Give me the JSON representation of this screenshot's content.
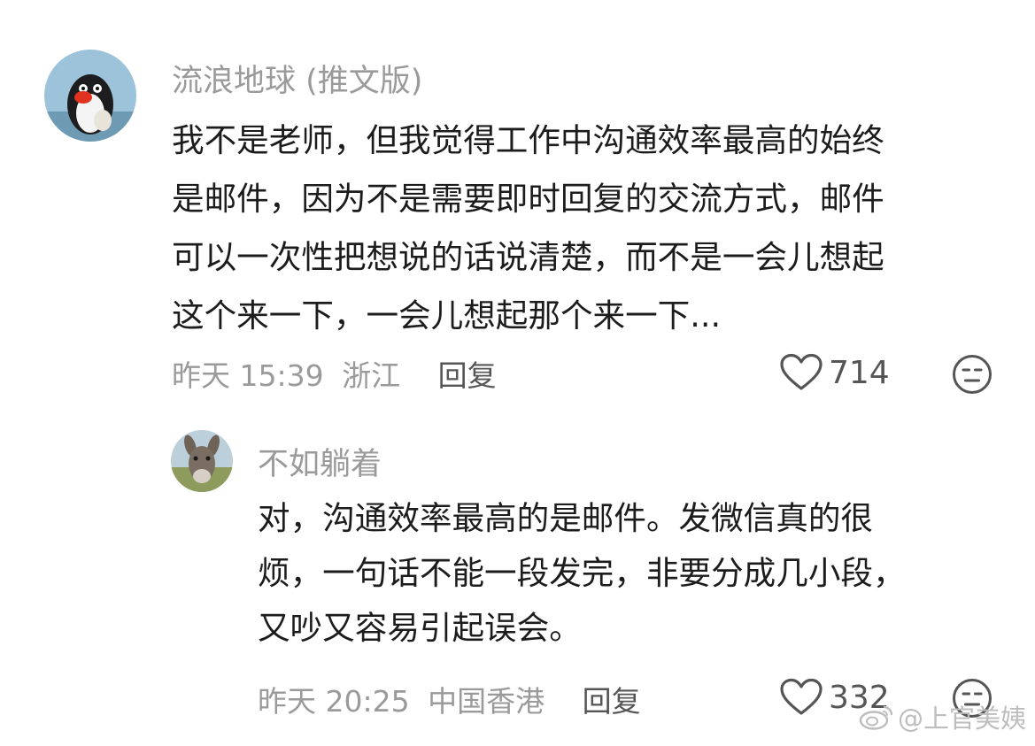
{
  "comments": [
    {
      "username": "流浪地球 (推文版)",
      "lines": [
        "我不是老师，但我觉得工作中沟通效率最高的始终",
        "是邮件，因为不是需要即时回复的交流方式，邮件",
        "可以一次性把想说的话说清楚，而不是一会儿想起",
        "这个来一下，一会儿想起那个来一下..."
      ],
      "time": "昨天 15:39",
      "location": "浙江",
      "reply_label": "回复",
      "likes": "714",
      "avatar_icon": "penguin-avatar-icon"
    },
    {
      "username": "不如躺着",
      "lines": [
        "对，沟通效率最高的是邮件。发微信真的很",
        "烦，一句话不能一段发完，非要分成几小段，",
        "又吵又容易引起误会。"
      ],
      "time": "昨天 20:25",
      "location": "中国香港",
      "reply_label": "回复",
      "likes": "332",
      "avatar_icon": "donkey-avatar-icon"
    }
  ],
  "watermark": {
    "text": "@上官美姨",
    "icon": "weibo-logo-icon"
  },
  "colors": {
    "text": "#1c1c1c",
    "secondary": "#9a9a9a",
    "action": "#555555",
    "background": "#ffffff"
  }
}
